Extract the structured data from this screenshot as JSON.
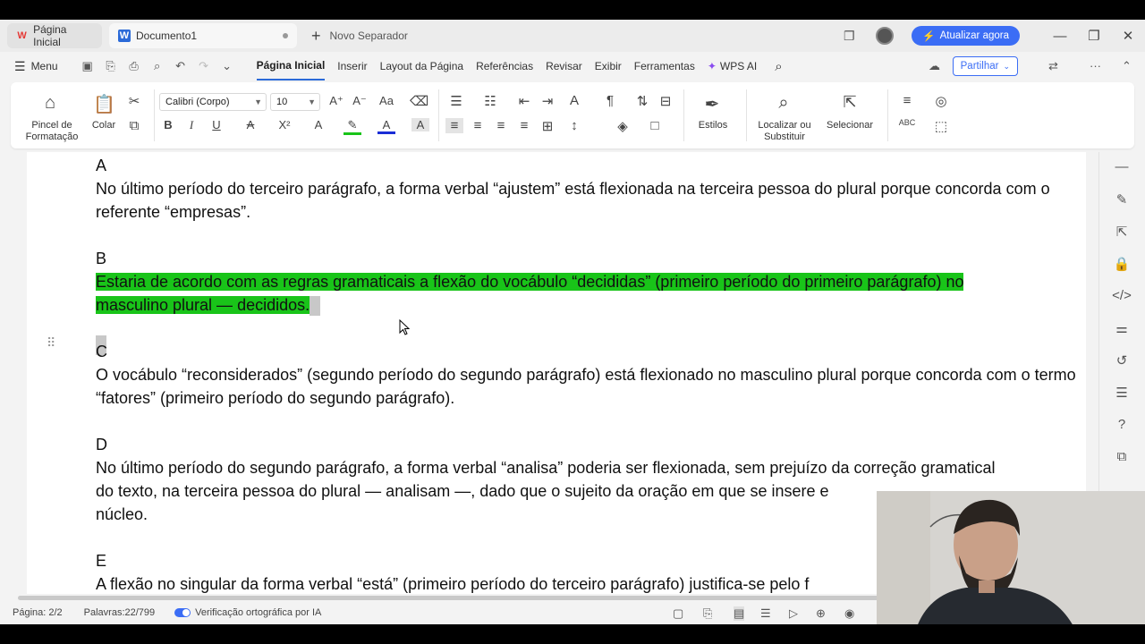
{
  "tabs": {
    "home": "Página Inicial",
    "doc": "Documento1",
    "new_tab": "Novo Separador"
  },
  "update_button": "Atualizar agora",
  "menu": {
    "label": "Menu",
    "tabs": [
      "Página Inicial",
      "Inserir",
      "Layout da Página",
      "Referências",
      "Revisar",
      "Exibir",
      "Ferramentas",
      "WPS AI"
    ],
    "share": "Partilhar"
  },
  "ribbon": {
    "format_painter": "Pincel de\nFormatação",
    "paste": "Colar",
    "font": "Calibri (Corpo)",
    "size": "10",
    "styles": "Estilos",
    "find_replace": "Localizar ou\nSubstituir",
    "select": "Selecionar"
  },
  "document": {
    "a_label": "A",
    "a_text": "No último período do terceiro parágrafo, a forma verbal “ajustem” está flexionada na terceira pessoa do plural porque concorda com o referente “empresas”.",
    "b_label": "B",
    "b_text1": "Estaria de acordo com as regras gramaticais a flexão do vocábulo “decididas” (primeiro período do primeiro parágrafo) no",
    "b_text2": "masculino plural — decididos.",
    "c_label": "C",
    "c_text": "O vocábulo “reconsiderados” (segundo período do segundo parágrafo) está flexionado no masculino plural porque concorda com o termo “fatores” (primeiro período do segundo parágrafo).",
    "d_label": "D",
    "d_text1": "No último período do segundo parágrafo, a forma verbal “analisa” poderia ser flexionada, sem prejuízo da correção gramatical",
    "d_text2": "do texto, na terceira pessoa do plural — analisam —, dado que o sujeito da oração em que se insere e",
    "d_text3": "núcleo.",
    "e_label": "E",
    "e_text": "A flexão no singular da forma verbal “está” (primeiro período do terceiro parágrafo) justifica-se pelo f"
  },
  "status": {
    "page": "Página: 2/2",
    "words": "Palavras:22/799",
    "spell": "Verificação ortográfica por IA"
  },
  "colors": {
    "highlight": "#19c419",
    "accent": "#3b6df5"
  }
}
